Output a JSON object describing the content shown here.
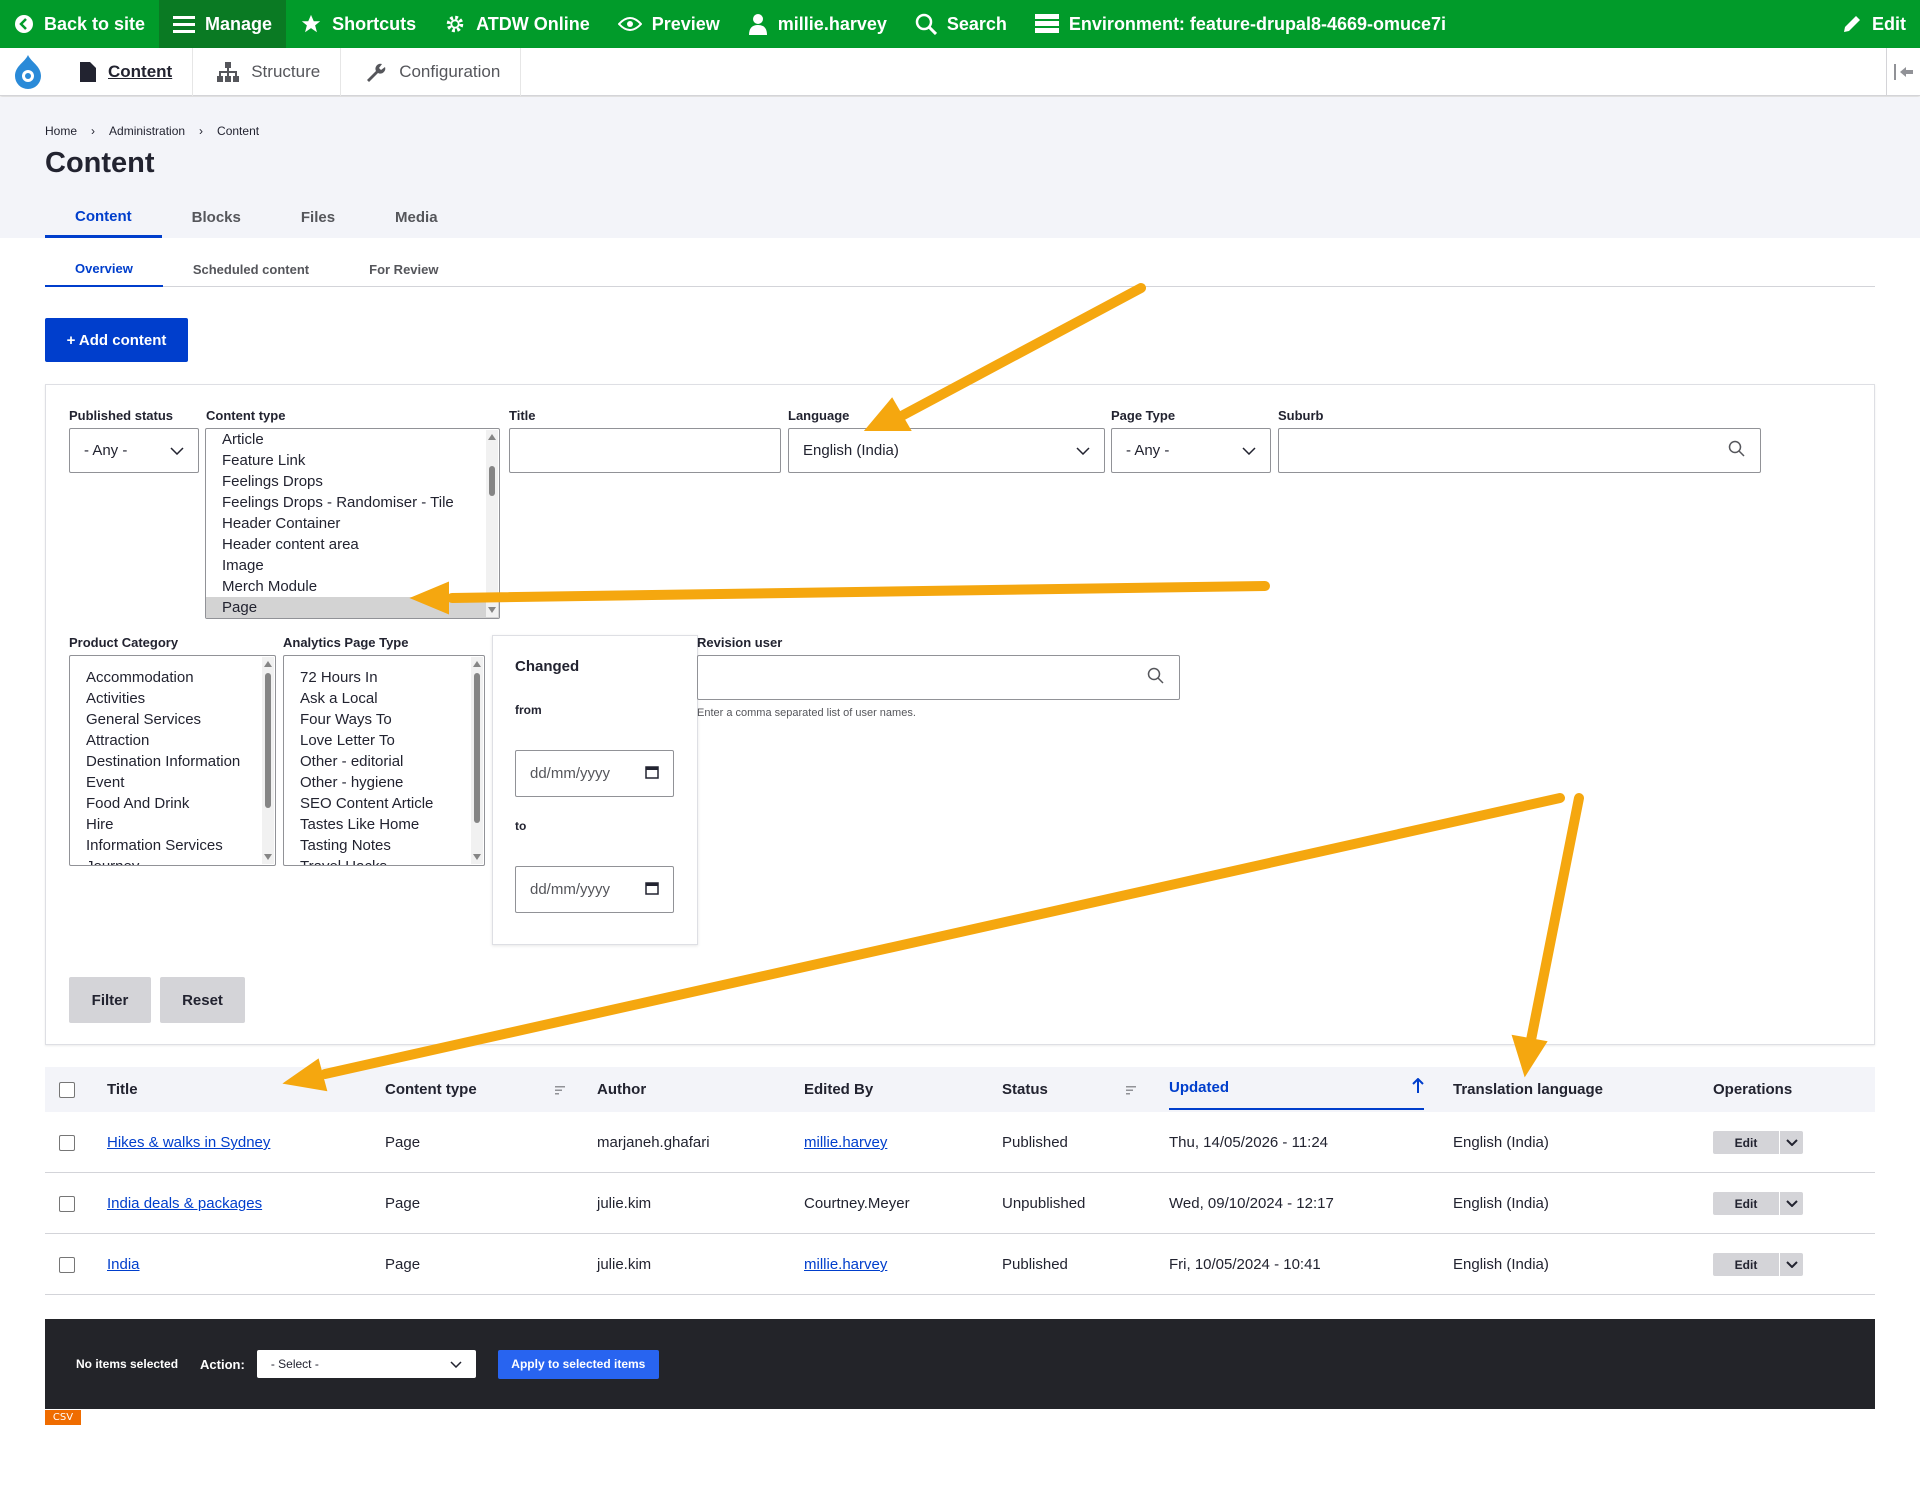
{
  "toolbar": {
    "back": "Back to site",
    "manage": "Manage",
    "shortcuts": "Shortcuts",
    "atdw": "ATDW Online",
    "preview": "Preview",
    "user": "millie.harvey",
    "search": "Search",
    "environment": "Environment: feature-drupal8-4669-omuce7i",
    "edit": "Edit"
  },
  "tray": {
    "content": "Content",
    "structure": "Structure",
    "configuration": "Configuration"
  },
  "breadcrumb": [
    "Home",
    "Administration",
    "Content"
  ],
  "page_title": "Content",
  "tabs": [
    "Content",
    "Blocks",
    "Files",
    "Media"
  ],
  "subtabs": [
    "Overview",
    "Scheduled content",
    "For Review"
  ],
  "add_content": "+ Add content",
  "filters": {
    "published_status": {
      "label": "Published status",
      "value": "- Any -"
    },
    "content_type": {
      "label": "Content type",
      "options": [
        "Article",
        "Feature Link",
        "Feelings Drops",
        "Feelings Drops - Randomiser - Tile",
        "Header Container",
        "Header content area",
        "Image",
        "Merch Module",
        "Page"
      ],
      "selected": "Page"
    },
    "title": {
      "label": "Title",
      "value": ""
    },
    "language": {
      "label": "Language",
      "value": "English (India)"
    },
    "page_type": {
      "label": "Page Type",
      "value": "- Any -"
    },
    "suburb": {
      "label": "Suburb",
      "value": ""
    },
    "product_category": {
      "label": "Product Category",
      "options": [
        "Accommodation",
        "Activities",
        "General Services",
        "Attraction",
        "Destination Information",
        "Event",
        "Food And Drink",
        "Hire",
        "Information Services",
        "Journey"
      ]
    },
    "analytics_page_type": {
      "label": "Analytics Page Type",
      "options": [
        "72 Hours In",
        "Ask a Local",
        "Four Ways To",
        "Love Letter To",
        "Other - editorial",
        "Other - hygiene",
        "SEO Content Article",
        "Tastes Like Home",
        "Tasting Notes",
        "Travel Hacks"
      ]
    },
    "changed": {
      "label": "Changed",
      "from_label": "from",
      "to_label": "to",
      "from_placeholder": "dd/mm/yyyy",
      "to_placeholder": "dd/mm/yyyy"
    },
    "revision_user": {
      "label": "Revision user",
      "help": "Enter a comma separated list of user names."
    },
    "filter_button": "Filter",
    "reset_button": "Reset"
  },
  "table": {
    "headers": [
      "Title",
      "Content type",
      "Author",
      "Edited By",
      "Status",
      "Updated",
      "Translation language",
      "Operations"
    ],
    "rows": [
      {
        "title": "Hikes & walks in Sydney",
        "type": "Page",
        "author": "marjaneh.ghafari",
        "edited_by": "millie.harvey",
        "edited_link": true,
        "status": "Published",
        "updated": "Thu, 14/05/2026 - 11:24",
        "lang": "English (India)",
        "op": "Edit"
      },
      {
        "title": "India deals & packages",
        "type": "Page",
        "author": "julie.kim",
        "edited_by": "Courtney.Meyer",
        "edited_link": false,
        "status": "Unpublished",
        "updated": "Wed, 09/10/2024 - 12:17",
        "lang": "English (India)",
        "op": "Edit"
      },
      {
        "title": "India",
        "type": "Page",
        "author": "julie.kim",
        "edited_by": "millie.harvey",
        "edited_link": true,
        "status": "Published",
        "updated": "Fri, 10/05/2024 - 10:41",
        "lang": "English (India)",
        "op": "Edit"
      }
    ]
  },
  "bulk": {
    "none_selected": "No items selected",
    "action_label": "Action:",
    "select_value": "- Select -",
    "apply": "Apply to selected items"
  },
  "csv": "CSV",
  "colors": {
    "toolbar": "#019b2a",
    "accent": "#003ecc",
    "annotation": "#f5a70f"
  }
}
